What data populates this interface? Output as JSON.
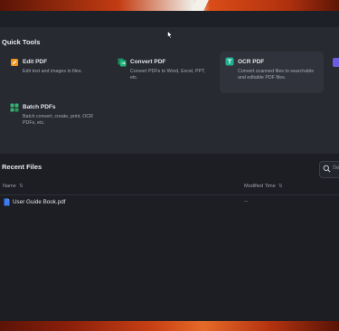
{
  "quick_tools": {
    "title": "Quick Tools",
    "items": [
      {
        "name": "Edit PDF",
        "desc": "Edit text and images in files.",
        "icon": "edit-pdf-icon"
      },
      {
        "name": "Convert PDF",
        "desc": "Convert PDFs to Word, Excel, PPT, etc.",
        "icon": "convert-pdf-icon"
      },
      {
        "name": "OCR PDF",
        "desc": "Convert scanned files to searchable and editable PDF files.",
        "icon": "ocr-pdf-icon"
      },
      {
        "name": "Batch PDFs",
        "desc": "Batch convert, create, print, OCR PDFs, etc.",
        "icon": "batch-pdfs-icon"
      }
    ]
  },
  "recent_files": {
    "title": "Recent Files",
    "search_placeholder": "Se",
    "columns": {
      "name": "Name",
      "modified": "Modified Time",
      "sort_glyph": "⇅"
    },
    "files": [
      {
        "name": "User Guide Book.pdf",
        "modified": "--"
      }
    ]
  },
  "colors": {
    "app_bg": "#23262d",
    "panel_bg": "#272a31",
    "recent_bg": "#1c1e23",
    "edit_icon": "#f0961f",
    "convert_icon": "#21b37a",
    "ocr_icon": "#1fb090",
    "batch_icon": "#34b36e",
    "file_icon": "#3d7bf0"
  }
}
